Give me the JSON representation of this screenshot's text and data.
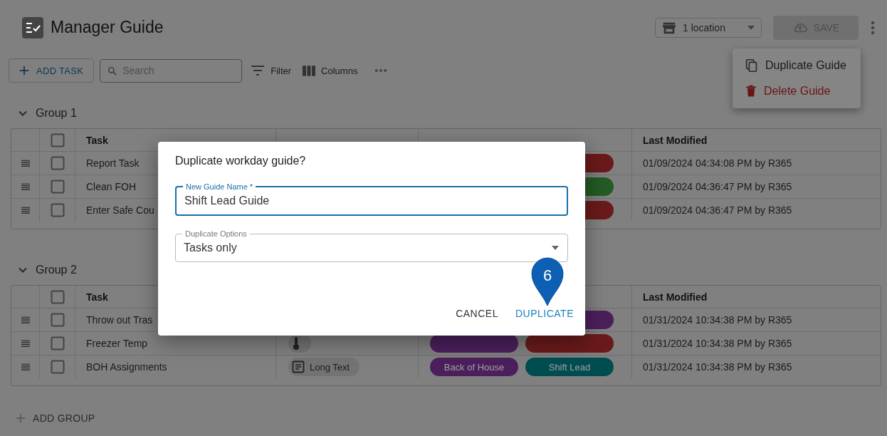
{
  "page": {
    "title": "Manager Guide"
  },
  "location_button": {
    "label": "1 location"
  },
  "save_button": {
    "label": "SAVE",
    "disabled": true
  },
  "menu": {
    "items": [
      {
        "kind": "copy",
        "label": "Duplicate Guide"
      },
      {
        "kind": "delete",
        "label": "Delete Guide"
      }
    ]
  },
  "toolbar": {
    "add_task": "ADD TASK",
    "search": {
      "placeholder": "Search"
    },
    "filter": "Filter",
    "columns": "Columns"
  },
  "groups": [
    {
      "name": "Group 1",
      "expanded": true,
      "columns": {
        "task": "Task",
        "last_modified": "Last Modified"
      },
      "all_checked": false,
      "rows": [
        {
          "checked": false,
          "task": "Report Task",
          "tags": [
            {
              "color": "#6a1a1a"
            }
          ],
          "last_modified": "01/09/2024 04:34:08 PM by R365"
        },
        {
          "checked": false,
          "task": "Clean FOH",
          "tags": [
            {
              "color": "#245a24"
            }
          ],
          "last_modified": "01/09/2024 04:36:47 PM by R365"
        },
        {
          "checked": false,
          "task": "Enter Safe Cou",
          "tags": [
            {
              "color": "#6a1a1a"
            }
          ],
          "last_modified": "01/09/2024 04:36:47 PM by R365"
        }
      ]
    },
    {
      "name": "Group 2",
      "expanded": true,
      "columns": {
        "task": "Task",
        "last_modified": "Last Modified"
      },
      "all_checked": false,
      "rows": [
        {
          "checked": false,
          "task": "Throw out Tras",
          "tags": [
            {
              "color": "#4b1f5c"
            }
          ],
          "last_modified": "01/31/2024 10:34:38 PM by R365"
        },
        {
          "checked": false,
          "task": "Freezer Temp",
          "type": {
            "kind": "temperature"
          },
          "tags": [
            {
              "color": "#4b1f5c"
            },
            {
              "color": "#6a1a1a"
            }
          ],
          "last_modified": "01/31/2024 10:34:38 PM by R365"
        },
        {
          "checked": false,
          "task": "BOH Assignments",
          "type": {
            "kind": "long_text",
            "label": "Long Text"
          },
          "tags": [
            {
              "color": "#4b1f5c",
              "label": "Back of House"
            },
            {
              "color": "#004d4f",
              "label": "Shift Lead"
            }
          ],
          "last_modified": "01/31/2024 10:34:38 PM by R365"
        }
      ]
    }
  ],
  "add_group": "ADD GROUP",
  "dialog": {
    "title": "Duplicate workday guide?",
    "name_field": {
      "label": "New Guide Name *",
      "value": "Shift Lead Guide",
      "focused": true
    },
    "options_field": {
      "label": "Duplicate Options",
      "value": "Tasks only"
    },
    "buttons": [
      {
        "kind": "secondary",
        "label": "CANCEL"
      },
      {
        "kind": "primary",
        "label": "DUPLICATE"
      }
    ]
  },
  "callout": {
    "number": "6"
  }
}
